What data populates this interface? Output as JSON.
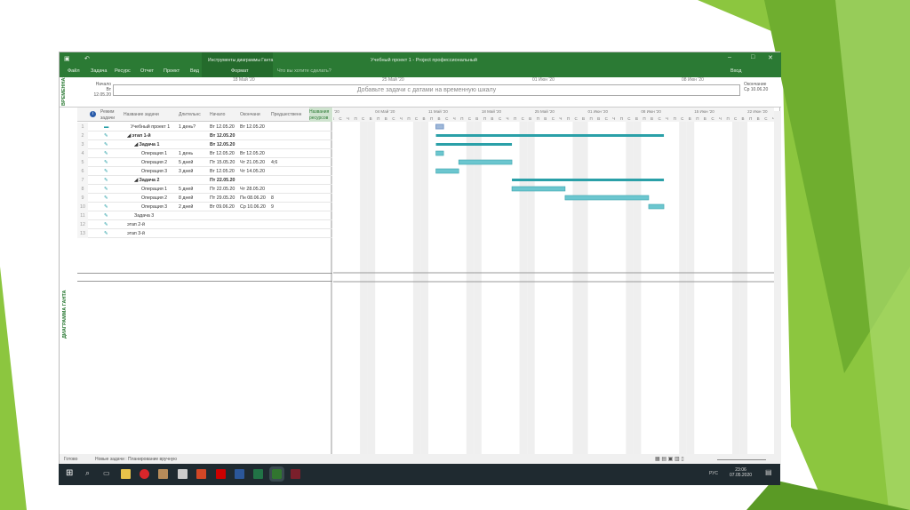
{
  "window": {
    "title": "Учебный проект 1 - Project профессиональный",
    "context_group": "Инструменты диаграммы Ганта",
    "search_placeholder": "Что вы хотите сделать?",
    "signin": "Вход"
  },
  "tabs": [
    "Файл",
    "Задача",
    "Ресурс",
    "Отчет",
    "Проект",
    "Вид",
    "Формат"
  ],
  "timeline": {
    "label": "ВРЕМЕННАЯ",
    "start_label": "Начало",
    "start": "Вт 12.05.20",
    "end_label": "Окончание",
    "end": "Ср 10.06.20",
    "placeholder": "Добавьте задачи с датами на временную шкалу",
    "ticks": [
      "18 Май '20",
      "25 Май '20",
      "01 Июн '20",
      "08 Июн '20"
    ]
  },
  "view_label": "ДИАГРАММА ГАНТА",
  "columns": [
    "Режим задачи",
    "Название задачи",
    "Длительнс",
    "Начало",
    "Окончани",
    "Предшественн",
    "Названия ресурсов"
  ],
  "gantt_weeks": [
    "'20",
    "04 Май '20",
    "11 Май '20",
    "18 Май '20",
    "25 Май '20",
    "01 Июн '20",
    "08 Июн '20",
    "15 Июн '20",
    "22 Июн '20"
  ],
  "day_letters": [
    "П",
    "В",
    "С",
    "Ч",
    "П",
    "С",
    "В"
  ],
  "rows": [
    {
      "id": "1",
      "name": "Учебный проект 1",
      "dur": "1 день?",
      "start": "Вт 12.05.20",
      "finish": "Вт 12.05.20",
      "pred": "",
      "level": 0,
      "bold": false,
      "bar": {
        "type": "proj",
        "from": "2020-05-12",
        "to": "2020-05-12"
      }
    },
    {
      "id": "2",
      "name": "этап 1-й",
      "dur": "",
      "start": "Вт 12.05.20",
      "finish": "",
      "pred": "",
      "level": 0,
      "bold": true,
      "bar": {
        "type": "sum",
        "from": "2020-05-12",
        "to": "2020-06-10"
      }
    },
    {
      "id": "3",
      "name": "Задача 1",
      "dur": "",
      "start": "Вт 12.05.20",
      "finish": "",
      "pred": "",
      "level": 1,
      "bold": true,
      "bar": {
        "type": "sum",
        "from": "2020-05-12",
        "to": "2020-05-21"
      }
    },
    {
      "id": "4",
      "name": "Операция 1",
      "dur": "1 день",
      "start": "Вт 12.05.20",
      "finish": "Вт 12.05.20",
      "pred": "",
      "level": 2,
      "bold": false,
      "bar": {
        "type": "task",
        "from": "2020-05-12",
        "to": "2020-05-12"
      }
    },
    {
      "id": "5",
      "name": "Операция 2",
      "dur": "5 дней",
      "start": "Пт 15.05.20",
      "finish": "Чт 21.05.20",
      "pred": "4;6",
      "level": 2,
      "bold": false,
      "bar": {
        "type": "task",
        "from": "2020-05-15",
        "to": "2020-05-21"
      }
    },
    {
      "id": "6",
      "name": "Операция 3",
      "dur": "3 дней",
      "start": "Вт 12.05.20",
      "finish": "Чт 14.05.20",
      "pred": "",
      "level": 2,
      "bold": false,
      "bar": {
        "type": "task",
        "from": "2020-05-12",
        "to": "2020-05-14"
      }
    },
    {
      "id": "7",
      "name": "Задача 2",
      "dur": "",
      "start": "Пт 22.05.20",
      "finish": "",
      "pred": "",
      "level": 1,
      "bold": true,
      "bar": {
        "type": "sum",
        "from": "2020-05-22",
        "to": "2020-06-10"
      }
    },
    {
      "id": "8",
      "name": "Операция 1",
      "dur": "5 дней",
      "start": "Пт 22.05.20",
      "finish": "Чт 28.05.20",
      "pred": "",
      "level": 2,
      "bold": false,
      "bar": {
        "type": "task",
        "from": "2020-05-22",
        "to": "2020-05-28"
      }
    },
    {
      "id": "9",
      "name": "Операция 2",
      "dur": "8 дней",
      "start": "Пт 29.05.20",
      "finish": "Пн 08.06.20",
      "pred": "8",
      "level": 2,
      "bold": false,
      "bar": {
        "type": "task",
        "from": "2020-05-29",
        "to": "2020-06-08"
      }
    },
    {
      "id": "10",
      "name": "Операция 3",
      "dur": "2 дней",
      "start": "Вт 09.06.20",
      "finish": "Ср 10.06.20",
      "pred": "9",
      "level": 2,
      "bold": false,
      "bar": {
        "type": "task",
        "from": "2020-06-09",
        "to": "2020-06-10"
      }
    },
    {
      "id": "11",
      "name": "Задача 3",
      "dur": "",
      "start": "",
      "finish": "",
      "pred": "",
      "level": 1,
      "bold": false,
      "bar": null
    },
    {
      "id": "12",
      "name": "этап 2-й",
      "dur": "",
      "start": "",
      "finish": "",
      "pred": "",
      "level": 0,
      "bold": false,
      "bar": null
    },
    {
      "id": "13",
      "name": "этап 3-й",
      "dur": "",
      "start": "",
      "finish": "",
      "pred": "",
      "level": 0,
      "bold": false,
      "bar": null
    }
  ],
  "status": {
    "ready": "Готово",
    "new_tasks": "Новые задачи : Планирование вручную"
  },
  "tray": {
    "lang": "РУС",
    "time": "23:06",
    "date": "07.05.2020"
  },
  "colors": {
    "ribbon": "#2b7a34",
    "bar": "#6cc6cf",
    "summary": "#2aa0a8",
    "accent_green": "#7dc242"
  }
}
